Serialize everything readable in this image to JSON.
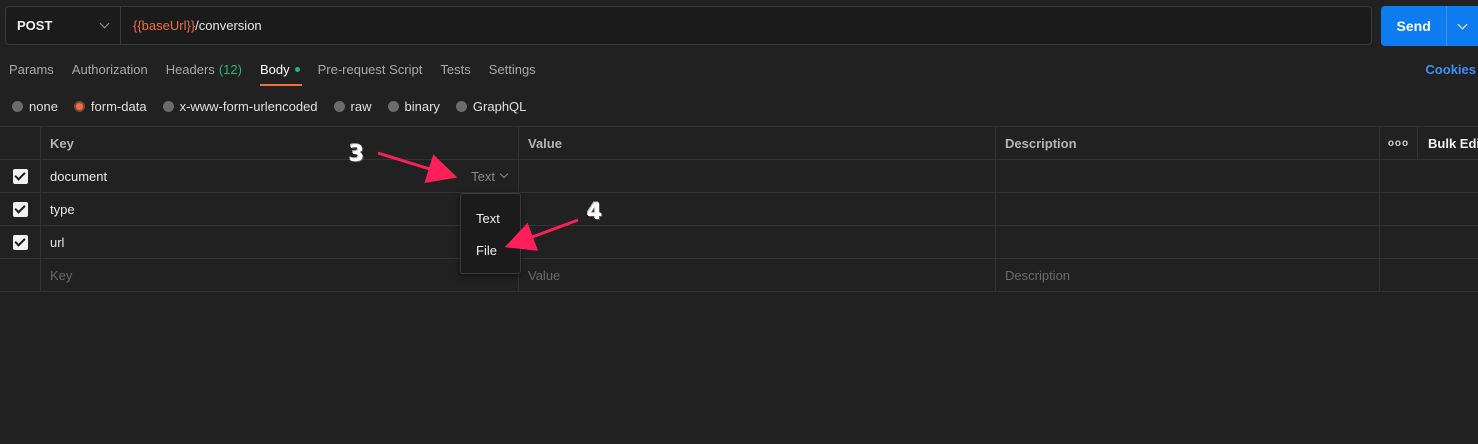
{
  "request": {
    "method": "POST",
    "url_var": "{{baseUrl}}",
    "url_path": "/conversion",
    "send_label": "Send"
  },
  "tabs": [
    {
      "label": "Params"
    },
    {
      "label": "Authorization"
    },
    {
      "label": "Headers",
      "count": "(12)"
    },
    {
      "label": "Body",
      "active": true
    },
    {
      "label": "Pre-request Script"
    },
    {
      "label": "Tests"
    },
    {
      "label": "Settings"
    }
  ],
  "cookies_label": "Cookies",
  "body_modes": [
    {
      "label": "none"
    },
    {
      "label": "form-data",
      "selected": true
    },
    {
      "label": "x-www-form-urlencoded"
    },
    {
      "label": "raw"
    },
    {
      "label": "binary"
    },
    {
      "label": "GraphQL"
    }
  ],
  "table": {
    "headers": {
      "key": "Key",
      "value": "Value",
      "description": "Description",
      "more": "ooo",
      "bulk_edit": "Bulk Edit"
    },
    "rows": [
      {
        "key": "document",
        "type": "Text"
      },
      {
        "key": "type"
      },
      {
        "key": "url"
      }
    ],
    "placeholders": {
      "key": "Key",
      "value": "Value",
      "description": "Description"
    }
  },
  "type_dropdown": {
    "options": [
      "Text",
      "File"
    ]
  },
  "annotations": {
    "step3": "3",
    "step4": "4",
    "arrow_color": "#ff1f5a"
  },
  "colors": {
    "accent": "#f36d3f",
    "send": "#0c7cf0",
    "success": "#26b47f",
    "link": "#3d8ef5"
  }
}
